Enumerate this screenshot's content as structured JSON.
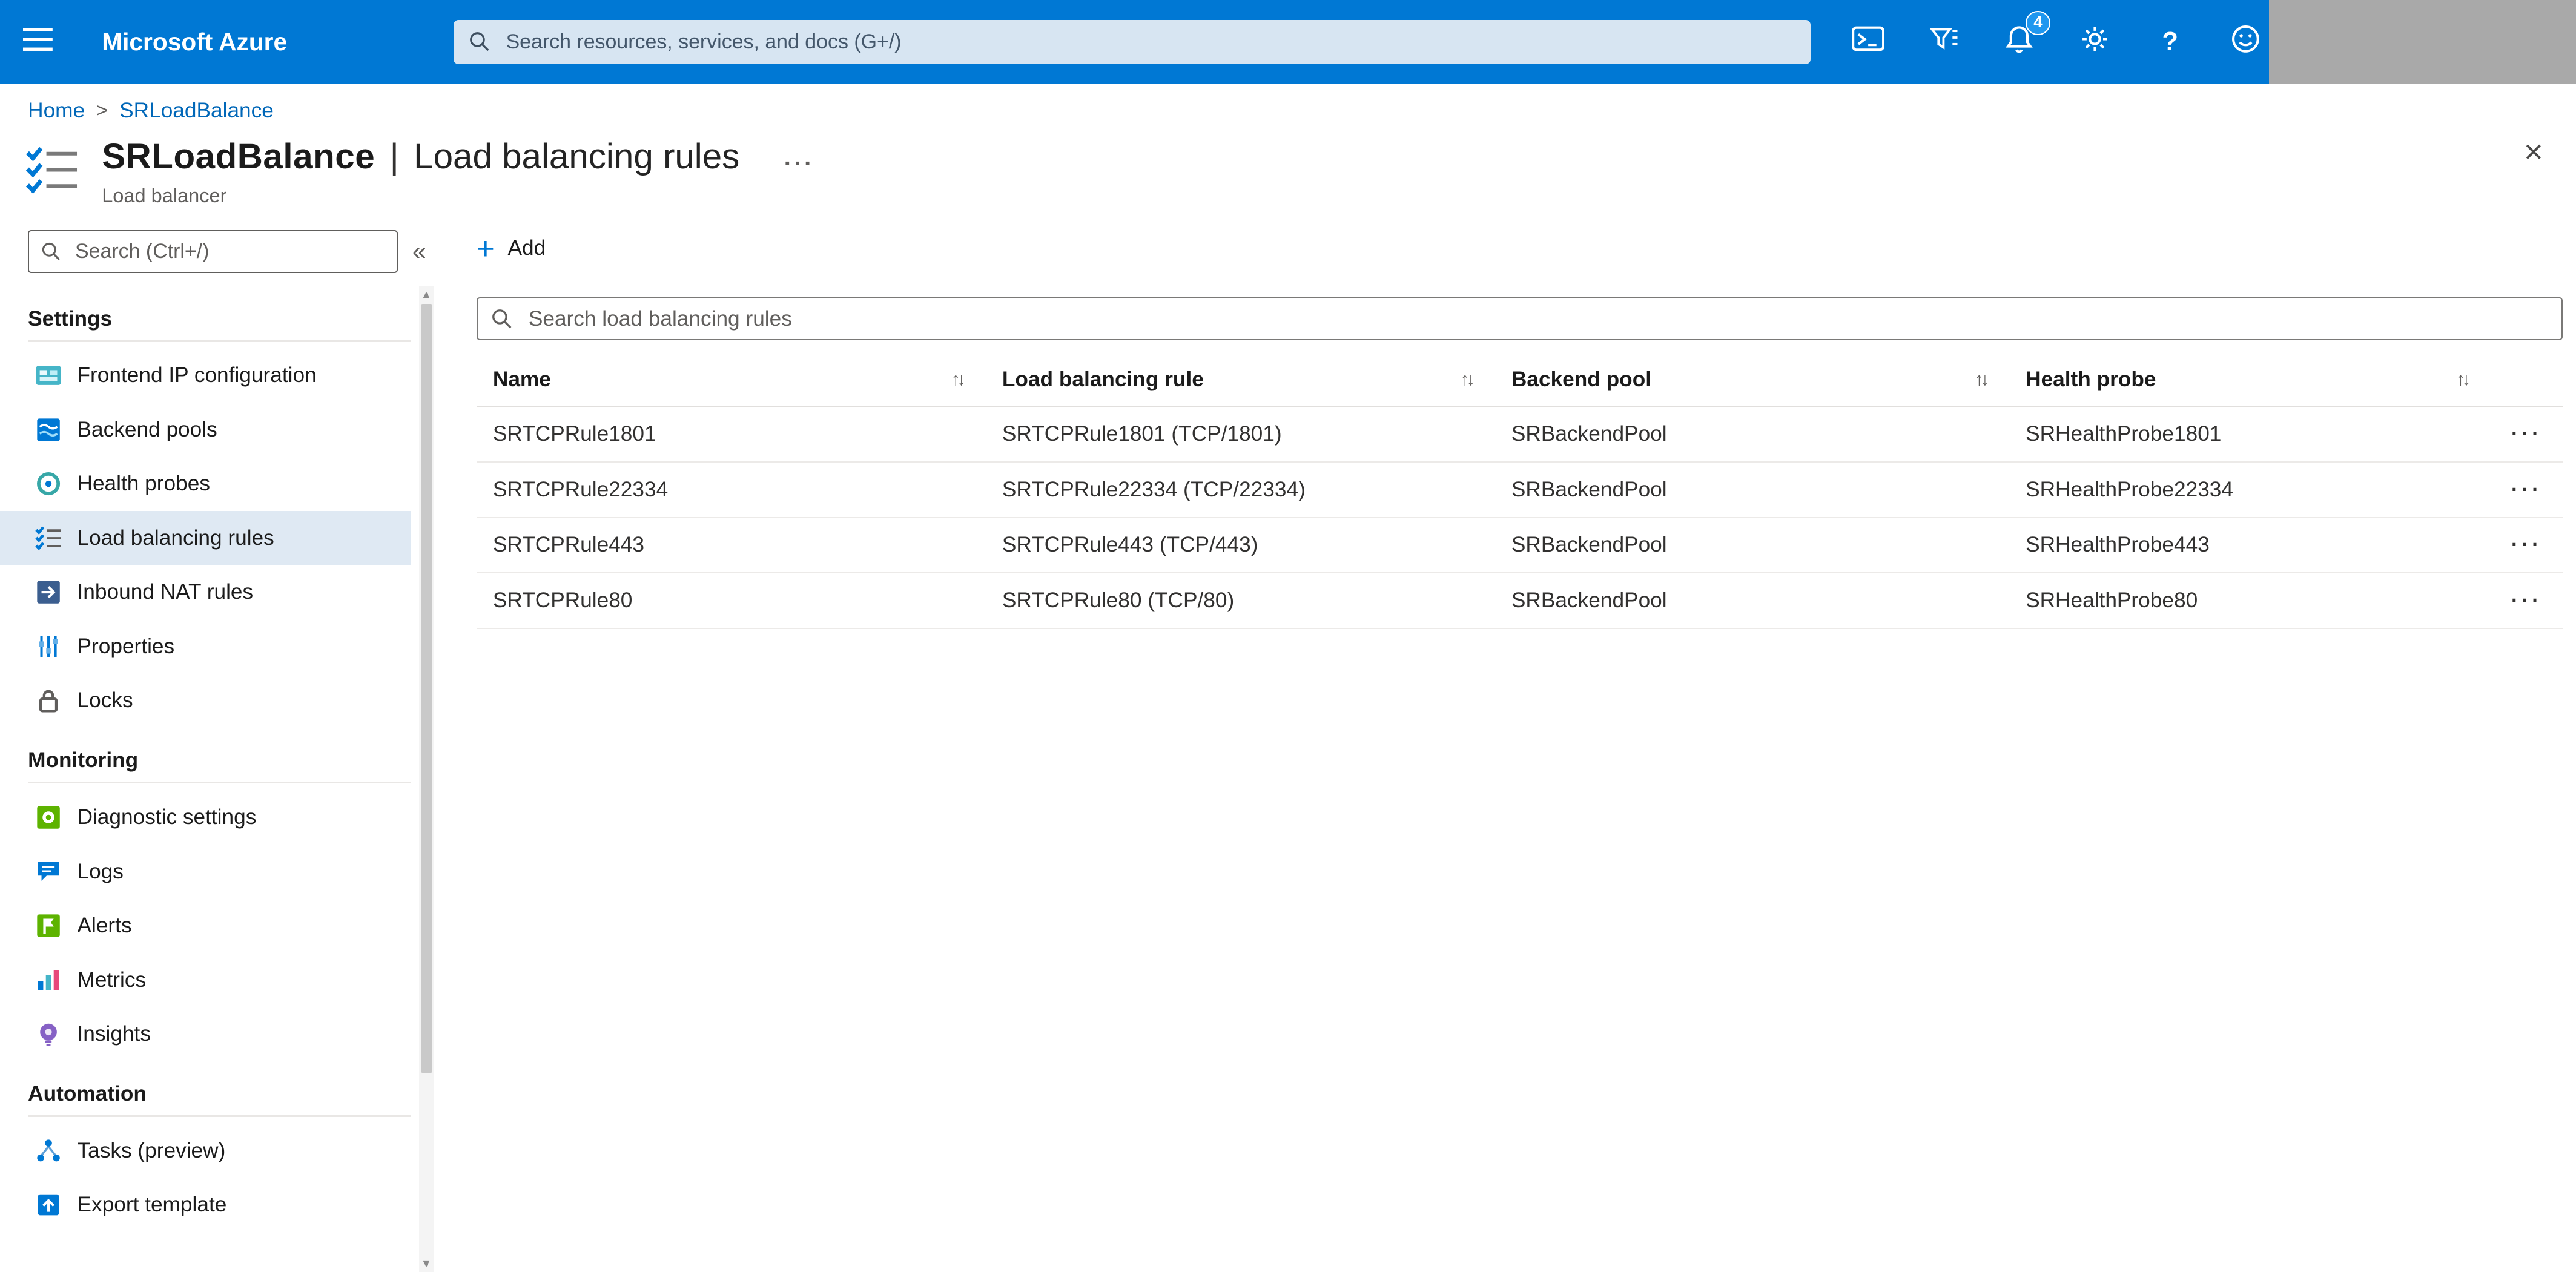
{
  "topbar": {
    "brand": "Microsoft Azure",
    "search_placeholder": "Search resources, services, and docs (G+/)",
    "notification_count": "4"
  },
  "icons": {
    "help_glyph": "?",
    "sort": "↑↓",
    "row_more": "···",
    "title_more": "...",
    "close": "×",
    "collapse": "«",
    "plus": "+",
    "breadcrumb_separator": ">",
    "scroll_up": "▲",
    "scroll_down": "▼"
  },
  "breadcrumb": {
    "items": [
      {
        "label": "Home"
      },
      {
        "label": "SRLoadBalance"
      }
    ]
  },
  "page": {
    "resource_name": "SRLoadBalance",
    "divider": "|",
    "blade_name": "Load balancing rules",
    "resource_type": "Load balancer"
  },
  "sidebar": {
    "search_placeholder": "Search (Ctrl+/)",
    "sections": [
      {
        "title": "Settings",
        "items": [
          {
            "label": "Frontend IP configuration",
            "icon": "frontend-ip-icon"
          },
          {
            "label": "Backend pools",
            "icon": "backend-pools-icon"
          },
          {
            "label": "Health probes",
            "icon": "health-probes-icon"
          },
          {
            "label": "Load balancing rules",
            "icon": "load-balancing-rules-icon",
            "selected": true
          },
          {
            "label": "Inbound NAT rules",
            "icon": "inbound-nat-rules-icon"
          },
          {
            "label": "Properties",
            "icon": "properties-icon"
          },
          {
            "label": "Locks",
            "icon": "lock-icon"
          }
        ]
      },
      {
        "title": "Monitoring",
        "items": [
          {
            "label": "Diagnostic settings",
            "icon": "diagnostic-settings-icon"
          },
          {
            "label": "Logs",
            "icon": "logs-icon"
          },
          {
            "label": "Alerts",
            "icon": "alerts-icon"
          },
          {
            "label": "Metrics",
            "icon": "metrics-icon"
          },
          {
            "label": "Insights",
            "icon": "insights-icon"
          }
        ]
      },
      {
        "title": "Automation",
        "items": [
          {
            "label": "Tasks (preview)",
            "icon": "tasks-icon"
          },
          {
            "label": "Export template",
            "icon": "export-template-icon"
          }
        ]
      }
    ]
  },
  "toolbar": {
    "add_label": "Add"
  },
  "main_search": {
    "placeholder": "Search load balancing rules"
  },
  "table": {
    "columns": [
      {
        "label": "Name"
      },
      {
        "label": "Load balancing rule"
      },
      {
        "label": "Backend pool"
      },
      {
        "label": "Health probe"
      }
    ],
    "rows": [
      {
        "name": "SRTCPRule1801",
        "rule": "SRTCPRule1801 (TCP/1801)",
        "backend_pool": "SRBackendPool",
        "health_probe": "SRHealthProbe1801"
      },
      {
        "name": "SRTCPRule22334",
        "rule": "SRTCPRule22334 (TCP/22334)",
        "backend_pool": "SRBackendPool",
        "health_probe": "SRHealthProbe22334"
      },
      {
        "name": "SRTCPRule443",
        "rule": "SRTCPRule443 (TCP/443)",
        "backend_pool": "SRBackendPool",
        "health_probe": "SRHealthProbe443"
      },
      {
        "name": "SRTCPRule80",
        "rule": "SRTCPRule80 (TCP/80)",
        "backend_pool": "SRBackendPool",
        "health_probe": "SRHealthProbe80"
      }
    ]
  },
  "colors": {
    "topbar": "#0078d4",
    "accent": "#0078d4",
    "link": "#0067b8",
    "selected_item_bg": "#dfe9f3",
    "muted_text": "#605e5c",
    "account_redacted": "#a9a9a9"
  }
}
